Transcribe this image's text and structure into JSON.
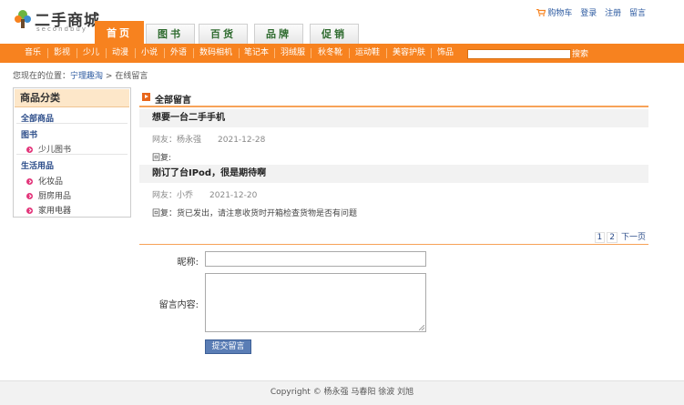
{
  "header": {
    "logo_text": "二手商城",
    "logo_sub": "secondbuy",
    "links": {
      "cart": "购物车",
      "login": "登录",
      "register": "注册",
      "guestbook": "留言"
    }
  },
  "tabs": [
    "首页",
    "图书",
    "百货",
    "品牌",
    "促销"
  ],
  "nav": {
    "items": [
      "音乐",
      "影视",
      "少儿",
      "动漫",
      "小说",
      "外语",
      "数码相机",
      "笔记本",
      "羽绒服",
      "秋冬靴",
      "运动鞋",
      "美容护肤",
      "饰品"
    ],
    "search_value": "",
    "search_label": "搜索"
  },
  "breadcrumb": {
    "prefix": "您现在的位置：",
    "home": "宁理趣淘",
    "sep": ">",
    "current": "在线留言"
  },
  "sidebar": {
    "title": "商品分类",
    "all": "全部商品",
    "cat_books": "图书",
    "books_items": [
      "少儿图书"
    ],
    "cat_living": "生活用品",
    "living_items": [
      "化妆品",
      "厨房用品",
      "家用电器"
    ]
  },
  "section_title": "全部留言",
  "messages": [
    {
      "title": "想要一台二手手机",
      "user": "网友：杨永强",
      "date": "2021-12-28",
      "reply": "回复:"
    },
    {
      "title": "刚订了台IPod，很是期待啊",
      "user": "网友：小乔",
      "date": "2021-12-20",
      "reply": "回复：货已发出，请注意收货时开箱检查货物是否有问题"
    }
  ],
  "pager": {
    "pages": [
      "1",
      "2"
    ],
    "next": "下一页"
  },
  "form": {
    "nickname_label": "昵称:",
    "nickname_value": "",
    "content_label": "留言内容:",
    "content_value": "",
    "submit": "提交留言"
  },
  "footer": "Copyright © 杨永强 马春阳 徐波 刘旭",
  "colors": {
    "accent": "#f7821f",
    "link": "#2c5aa0",
    "button": "#5a7db5"
  }
}
